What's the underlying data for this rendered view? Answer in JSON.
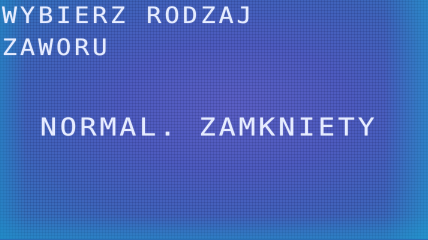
{
  "display": {
    "title_line_1": "WYBIERZ RODZAJ",
    "title_line_2": "ZAWORU",
    "selected_option": "NORMAL. ZAMKNIETY"
  },
  "colors": {
    "lcd_background": "#4d5bbf",
    "lcd_text": "#e6ecff"
  }
}
